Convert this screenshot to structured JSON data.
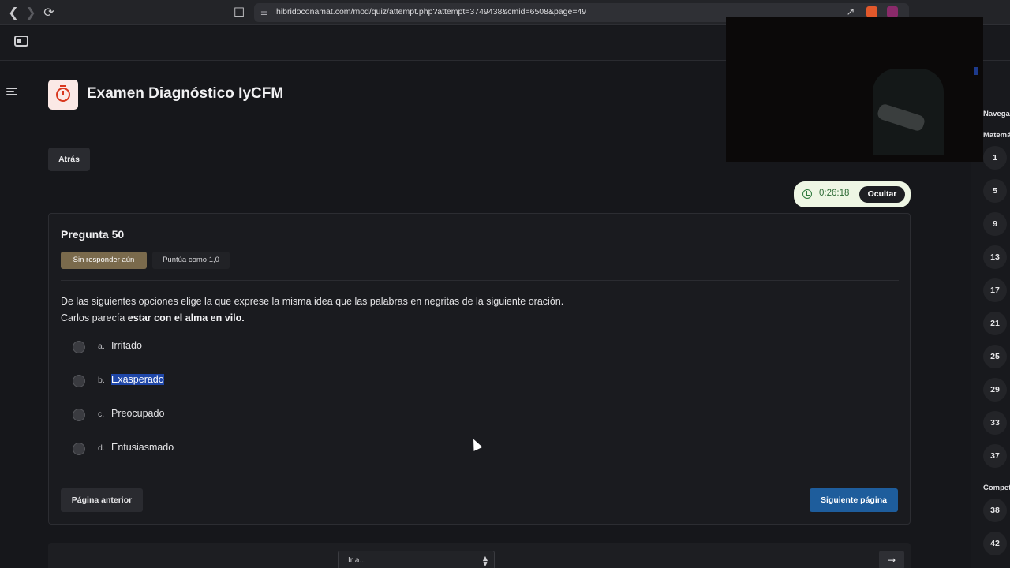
{
  "browser": {
    "url": "hibridoconamat.com/mod/quiz/attempt.php?attempt=3749438&cmid=6508&page=49"
  },
  "header": {
    "title": "Examen Diagnóstico IyCFM",
    "back_label": "Atrás"
  },
  "timer": {
    "time": "0:26:18",
    "hide_label": "Ocultar"
  },
  "question": {
    "number_label": "Pregunta 50",
    "status": "Sin responder aún",
    "grade": "Puntúa como 1,0",
    "prompt": "De las siguientes opciones elige la que exprese la misma idea que las palabras en negritas de la siguiente oración.",
    "sentence_lead": "Carlos parecía ",
    "sentence_bold": "estar con el alma en vilo.",
    "options": [
      {
        "letter": "a.",
        "text": "Irritado"
      },
      {
        "letter": "b.",
        "text": "Exasperado"
      },
      {
        "letter": "c.",
        "text": "Preocupado"
      },
      {
        "letter": "d.",
        "text": "Entusiasmado"
      }
    ],
    "selected_text_option": "b",
    "prev_label": "Página anterior",
    "next_label": "Siguiente página"
  },
  "jump": {
    "placeholder": "Ir a..."
  },
  "right_nav": {
    "heading": "Navega",
    "section1": "Matemá",
    "numbers1": [
      "1",
      "5",
      "9",
      "13",
      "17",
      "21",
      "25",
      "29",
      "33",
      "37"
    ],
    "section2": "Compet",
    "numbers2": [
      "38",
      "42"
    ]
  },
  "colors": {
    "timer_bg": "#eef6e4",
    "next_button": "#1e5d9c",
    "status_badge": "#7a6a4c",
    "selection_highlight": "#1f47a8"
  },
  "icons": [
    "back-arrow-icon",
    "forward-arrow-icon",
    "reload-icon",
    "bookmark-icon",
    "site-settings-icon",
    "share-icon",
    "brave-icon",
    "rewards-icon",
    "drawer-icon",
    "menu-icon",
    "stopwatch-icon",
    "clock-icon",
    "arrow-right-icon"
  ]
}
